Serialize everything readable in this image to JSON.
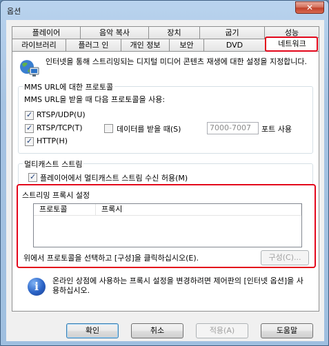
{
  "window": {
    "title": "옵션",
    "close_glyph": "✕"
  },
  "tabs_back": [
    "플레이어",
    "음악 복사",
    "장치",
    "굽기",
    "성능"
  ],
  "tabs_front": [
    "라이브러리",
    "플러그 인",
    "개인 정보",
    "보안",
    "DVD",
    "네트워크"
  ],
  "intro": {
    "text": "인터넷을 통해 스트리밍되는 디지털 미디어 콘텐츠 재생에 대한 설정을 지정합니다."
  },
  "mms": {
    "title": "MMS URL에 대한 프로토콜",
    "desc": "MMS URL을 받을 때 다음 프로토콜을 사용:",
    "rtsp_udp": "RTSP/UDP(U)",
    "rtsp_tcp": "RTSP/TCP(T)",
    "http": "HTTP(H)",
    "ports_label": "데이터를 받을 때(S)",
    "ports_value": "7000-7007",
    "ports_suffix": "포트 사용"
  },
  "multicast": {
    "title": "멀티캐스트 스트림",
    "allow": "플레이어에서 멀티캐스트 스트림 수신 허용(M)"
  },
  "proxy": {
    "title": "스트리밍 프록시 설정",
    "col_protocol": "프로토콜",
    "col_proxy": "프록시",
    "hint": "위에서 프로토콜을 선택하고 [구성]을 클릭하십시오(E).",
    "configure": "구성(C)..."
  },
  "info": {
    "text": "온라인 상점에 사용하는 프록시 설정을 변경하려면 제어판의 [인터넷 옵션]을 사용하십시오."
  },
  "buttons": {
    "ok": "확인",
    "cancel": "취소",
    "apply": "적용(A)",
    "help": "도움말"
  }
}
